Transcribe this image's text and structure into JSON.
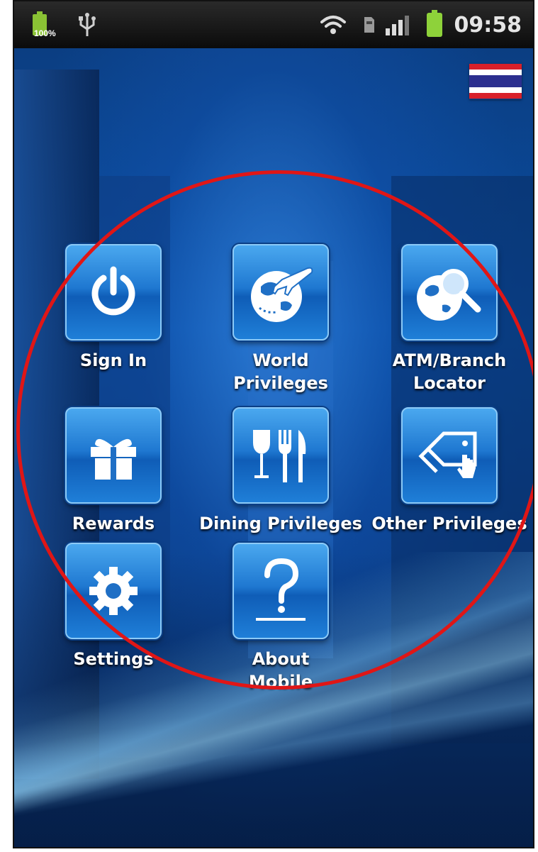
{
  "status_bar": {
    "battery_percent_left": "100%",
    "time": "09:58"
  },
  "language_flag": "thai-flag-icon",
  "menu": {
    "items": [
      {
        "label_lines": [
          "Sign In"
        ],
        "icon": "power-icon"
      },
      {
        "label_lines": [
          "World",
          "Privileges"
        ],
        "icon": "globe-plane-icon"
      },
      {
        "label_lines": [
          "ATM/Branch",
          "Locator"
        ],
        "icon": "globe-search-icon"
      },
      {
        "label_lines": [
          "Rewards"
        ],
        "icon": "gift-icon"
      },
      {
        "label_lines": [
          "Dining Privileges"
        ],
        "icon": "dining-icon"
      },
      {
        "label_lines": [
          "Other Privileges"
        ],
        "icon": "tags-icon"
      },
      {
        "label_lines": [
          "Settings"
        ],
        "icon": "gear-icon"
      },
      {
        "label_lines": [
          "About",
          "Mobile"
        ],
        "icon": "question-icon"
      }
    ]
  },
  "colors": {
    "tile_blue": "#1f78d1",
    "highlight_circle": "#e01616",
    "battery_green": "#8ed23a"
  }
}
